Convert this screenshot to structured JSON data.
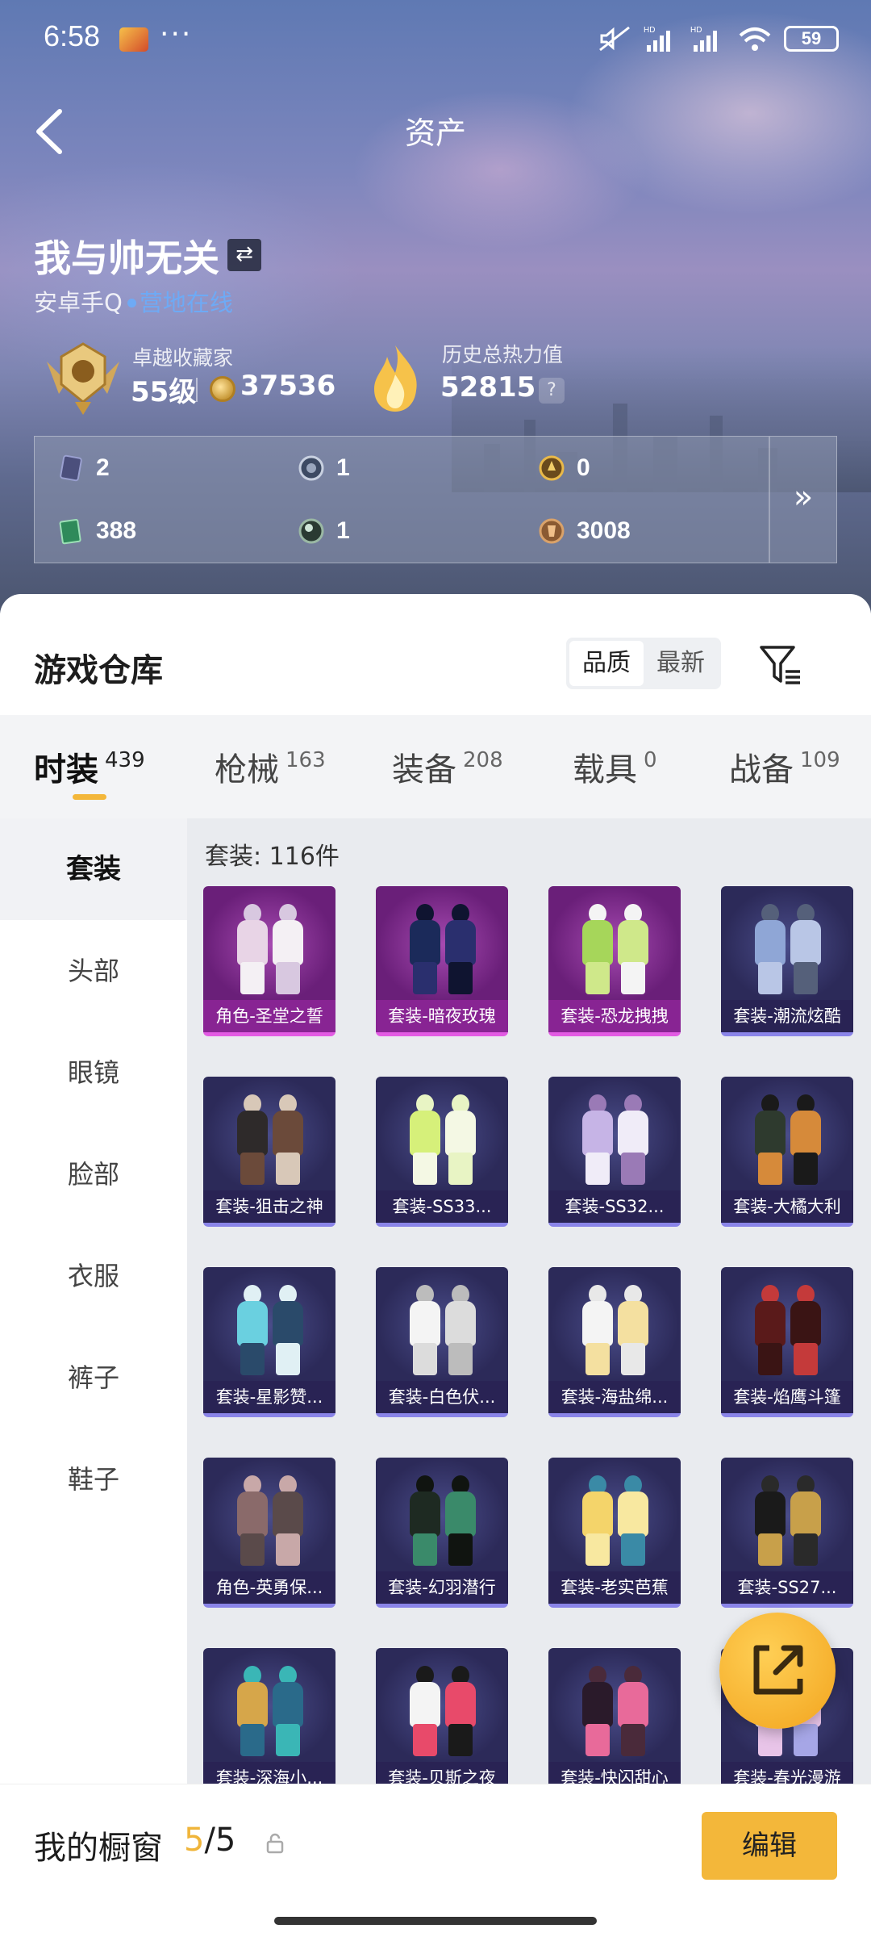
{
  "status": {
    "time": "6:58",
    "dots": "···",
    "battery": "59"
  },
  "nav": {
    "title": "资产",
    "back": "back"
  },
  "profile": {
    "name": "我与帅无关",
    "platform_prefix": "安卓手Q",
    "online": "营地在线"
  },
  "collector": {
    "label": "卓越收藏家",
    "level": "55级",
    "points": "37536"
  },
  "heat": {
    "label": "历史总热力值",
    "value": "52815",
    "help": "?"
  },
  "currencies": [
    {
      "value": "2",
      "icon": "card-icon"
    },
    {
      "value": "1",
      "icon": "token-icon"
    },
    {
      "value": "0",
      "icon": "gold-token-icon"
    },
    {
      "value": "388",
      "icon": "ticket-icon"
    },
    {
      "value": "1",
      "icon": "orb-icon"
    },
    {
      "value": "3008",
      "icon": "bronze-coin-icon"
    }
  ],
  "panel_more": "»",
  "warehouse": {
    "title": "游戏仓库",
    "sort": [
      "品质",
      "最新"
    ],
    "tabs": [
      {
        "label": "时装",
        "count": "439"
      },
      {
        "label": "枪械",
        "count": "163"
      },
      {
        "label": "装备",
        "count": "208"
      },
      {
        "label": "载具",
        "count": "0"
      },
      {
        "label": "战备",
        "count": "109"
      }
    ],
    "categories": [
      "套装",
      "头部",
      "眼镜",
      "脸部",
      "衣服",
      "裤子",
      "鞋子"
    ],
    "count_text": "套装: 116件",
    "items": [
      {
        "label": "角色-圣堂之誓",
        "rarity": "purple"
      },
      {
        "label": "套装-暗夜玫瑰",
        "rarity": "purple"
      },
      {
        "label": "套装-恐龙拽拽",
        "rarity": "purple"
      },
      {
        "label": "套装-潮流炫酷",
        "rarity": "blue"
      },
      {
        "label": "套装-狙击之神",
        "rarity": "blue"
      },
      {
        "label": "套装-SS33...",
        "rarity": "blue"
      },
      {
        "label": "套装-SS32...",
        "rarity": "blue"
      },
      {
        "label": "套装-大橘大利",
        "rarity": "blue"
      },
      {
        "label": "套装-星影赞...",
        "rarity": "blue"
      },
      {
        "label": "套装-白色伏...",
        "rarity": "blue"
      },
      {
        "label": "套装-海盐绵...",
        "rarity": "blue"
      },
      {
        "label": "套装-焰鹰斗篷",
        "rarity": "blue"
      },
      {
        "label": "角色-英勇保...",
        "rarity": "blue"
      },
      {
        "label": "套装-幻羽潜行",
        "rarity": "blue"
      },
      {
        "label": "套装-老实芭蕉",
        "rarity": "blue"
      },
      {
        "label": "套装-SS27...",
        "rarity": "blue"
      },
      {
        "label": "套装-深海小...",
        "rarity": "blue"
      },
      {
        "label": "套装-贝斯之夜",
        "rarity": "blue"
      },
      {
        "label": "套装-快闪甜心",
        "rarity": "blue"
      },
      {
        "label": "套装-春光漫游",
        "rarity": "blue"
      }
    ]
  },
  "showcase": {
    "title": "我的橱窗",
    "current": "5",
    "total": "/5",
    "edit": "编辑"
  }
}
